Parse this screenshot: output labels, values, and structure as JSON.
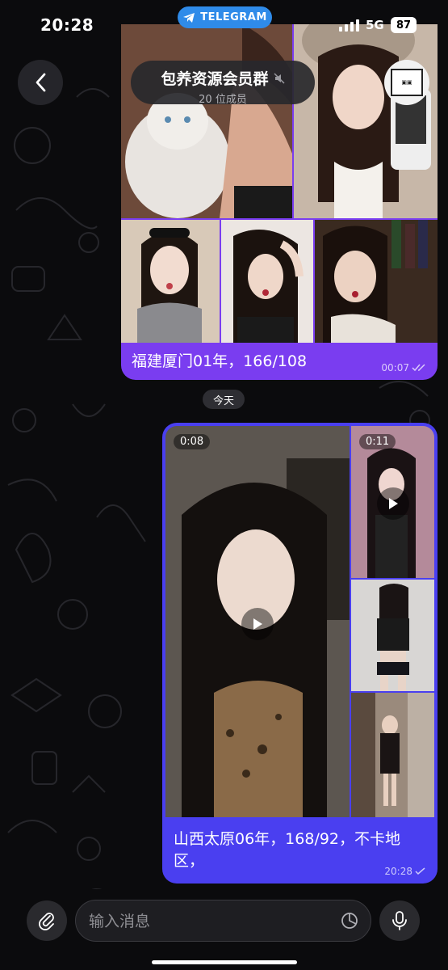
{
  "status": {
    "time": "20:28",
    "app_pill": "TELEGRAM",
    "network": "5G",
    "battery": "87"
  },
  "header": {
    "title": "包养资源会员群",
    "subtitle": "20 位成员",
    "avatar_icon": "group-logo-icon"
  },
  "messages": [
    {
      "direction": "incoming",
      "caption": "福建厦门01年，166/108",
      "time": "00:07",
      "status_icon": "double-check-icon",
      "media_count": 5
    },
    {
      "direction": "outgoing",
      "caption": "山西太原06年，168/92，不卡地区，",
      "time": "20:28",
      "status_icon": "single-check-icon",
      "videos": [
        {
          "duration": "0:08"
        },
        {
          "duration": "0:11"
        }
      ]
    }
  ],
  "date_separator": "今天",
  "composer": {
    "placeholder": "输入消息"
  },
  "colors": {
    "incoming_bubble": "#7a3df0",
    "outgoing_bubble": "#4a3ff0",
    "telegram_blue": "#2f8be9"
  }
}
